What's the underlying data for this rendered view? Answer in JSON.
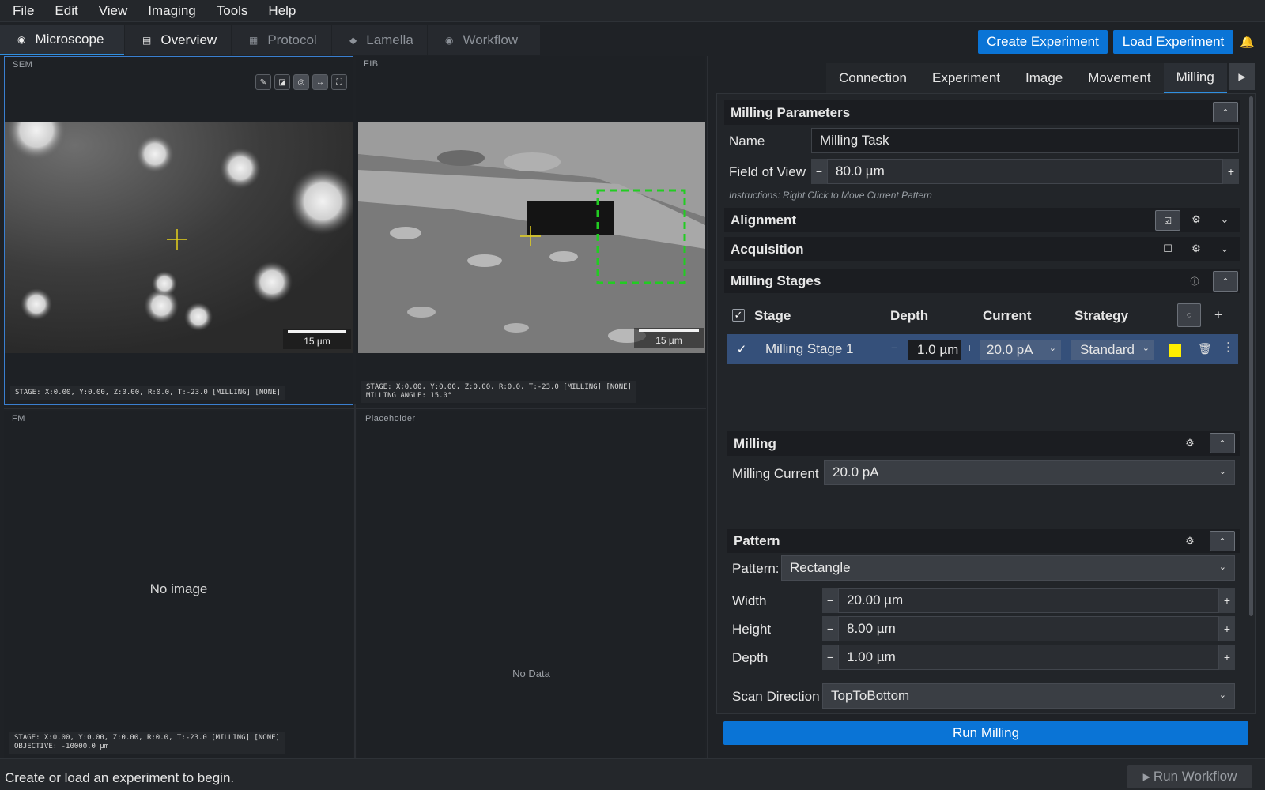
{
  "menu": [
    "File",
    "Edit",
    "View",
    "Imaging",
    "Tools",
    "Help"
  ],
  "top_tabs": [
    {
      "label": "Microscope",
      "icon": "microscope-icon",
      "glyph": "◉"
    },
    {
      "label": "Overview",
      "icon": "map-icon",
      "glyph": "▤"
    },
    {
      "label": "Protocol",
      "icon": "document-icon",
      "glyph": "▦"
    },
    {
      "label": "Lamella",
      "icon": "layers-icon",
      "glyph": "◆"
    },
    {
      "label": "Workflow",
      "icon": "play-circle-icon",
      "glyph": "◉"
    }
  ],
  "header_buttons": {
    "create": "Create Experiment",
    "load": "Load Experiment"
  },
  "viewers": {
    "sem": {
      "label": "SEM",
      "scale": "15 µm",
      "status": "STAGE: X:0.00, Y:0.00, Z:0.00, R:0.0, T:-23.0 [MILLING] [NONE]"
    },
    "fib": {
      "label": "FIB",
      "scale": "15 µm",
      "status1": "STAGE: X:0.00, Y:0.00, Z:0.00, R:0.0, T:-23.0 [MILLING] [NONE]",
      "status2": "MILLING ANGLE: 15.0°"
    },
    "fm": {
      "label": "FM",
      "empty": "No image",
      "status1": "STAGE: X:0.00, Y:0.00, Z:0.00, R:0.0, T:-23.0 [MILLING] [NONE]",
      "status2": "OBJECTIVE: -10000.0 µm"
    },
    "placeholder": {
      "label": "Placeholder",
      "empty": "No Data"
    }
  },
  "side_tabs": [
    "Connection",
    "Experiment",
    "Image",
    "Movement",
    "Milling"
  ],
  "milling_params": {
    "title": "Milling Parameters",
    "name_label": "Name",
    "name_value": "Milling Task",
    "fov_label": "Field of View",
    "fov_value": "80.0  µm",
    "instructions": "Instructions: Right Click to Move Current Pattern"
  },
  "alignment": {
    "title": "Alignment"
  },
  "acquisition": {
    "title": "Acquisition"
  },
  "stages": {
    "title": "Milling Stages",
    "headers": {
      "stage": "Stage",
      "depth": "Depth",
      "current": "Current",
      "strategy": "Strategy"
    },
    "rows": [
      {
        "name": "Milling Stage 1",
        "depth": "1.0 µm",
        "current": "20.0 pA",
        "strategy": "Standard",
        "color": "#ffee00"
      }
    ]
  },
  "milling": {
    "title": "Milling",
    "current_label": "Milling Current",
    "current_value": "20.0 pA"
  },
  "pattern": {
    "title": "Pattern",
    "pattern_label": "Pattern:",
    "pattern_value": "Rectangle",
    "width_label": "Width",
    "width_value": "20.00 µm",
    "height_label": "Height",
    "height_value": "8.00 µm",
    "depth_label": "Depth",
    "depth_value": "1.00 µm",
    "scan_label": "Scan Direction",
    "scan_value": "TopToBottom"
  },
  "run_milling": "Run Milling",
  "status_message": "Create or load an experiment to begin.",
  "run_workflow": "Run Workflow",
  "colors": {
    "accent": "#0a74d6",
    "crosshair": "#e6d21c",
    "pattern_outline": "#22cc22",
    "stage_color": "#ffee00"
  }
}
